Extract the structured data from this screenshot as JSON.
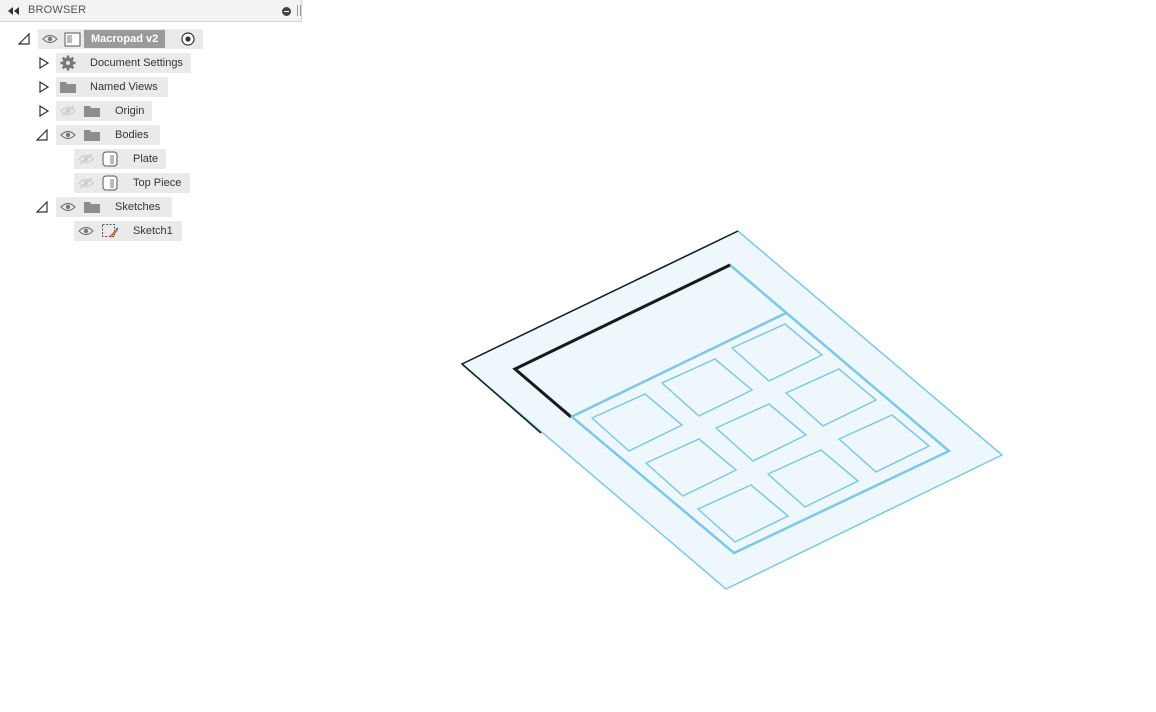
{
  "browser": {
    "title": "BROWSER",
    "root": {
      "label": "Macropad v2"
    },
    "items": [
      {
        "label": "Document Settings",
        "icon": "gear-icon"
      },
      {
        "label": "Named Views",
        "icon": "folder-icon"
      },
      {
        "label": "Origin",
        "icon": "folder-icon",
        "visible": false
      },
      {
        "label": "Bodies",
        "icon": "folder-icon",
        "visible": true
      },
      {
        "label": "Plate",
        "icon": "body-icon",
        "visible": false
      },
      {
        "label": "Top Piece",
        "icon": "body-icon",
        "visible": false
      },
      {
        "label": "Sketches",
        "icon": "folder-icon",
        "visible": true
      },
      {
        "label": "Sketch1",
        "icon": "sketch-icon",
        "visible": true
      }
    ]
  },
  "colors": {
    "sketch_line": "#7cc8e6",
    "sketch_fill": "#eef7fc",
    "edge_dark": "#1a1a1a",
    "panel_bg": "#f3f3f3",
    "node_bg": "#eaeaea",
    "root_bg": "#9a9a9a"
  }
}
